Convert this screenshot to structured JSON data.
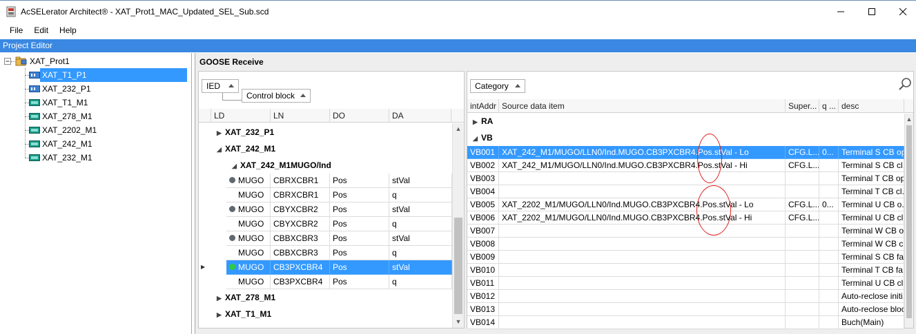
{
  "window": {
    "title": "AcSELerator Architect® - XAT_Prot1_MAC_Updated_SEL_Sub.scd"
  },
  "menu": [
    "File",
    "Edit",
    "Help"
  ],
  "project_editor": {
    "label": "Project Editor"
  },
  "tree": {
    "root": "XAT_Prot1",
    "items": [
      {
        "label": "XAT_T1_P1",
        "icon": "ied-blue-icon",
        "selected": true
      },
      {
        "label": "XAT_232_P1",
        "icon": "ied-blue-icon",
        "selected": false
      },
      {
        "label": "XAT_T1_M1",
        "icon": "ied-teal-icon",
        "selected": false
      },
      {
        "label": "XAT_278_M1",
        "icon": "ied-teal-icon",
        "selected": false
      },
      {
        "label": "XAT_2202_M1",
        "icon": "ied-teal-icon",
        "selected": false
      },
      {
        "label": "XAT_242_M1",
        "icon": "ied-teal-icon",
        "selected": false
      },
      {
        "label": "XAT_232_M1",
        "icon": "ied-teal-icon",
        "selected": false
      }
    ]
  },
  "goose": {
    "title": "GOOSE Receive",
    "left": {
      "group_buttons": [
        "IED",
        "Control block"
      ],
      "columns": [
        "LD",
        "LN",
        "DO",
        "DA"
      ],
      "groups": {
        "g1": "XAT_232_P1",
        "g2": "XAT_242_M1",
        "sub": "XAT_242_M1MUGO/Ind",
        "g3": "XAT_278_M1",
        "g4": "XAT_T1_M1"
      },
      "rows": [
        {
          "ld": "MUGO",
          "ln": "CBRXCBR1",
          "do": "Pos",
          "da": "stVal",
          "dot": "gray",
          "selected": false
        },
        {
          "ld": "MUGO",
          "ln": "CBRXCBR1",
          "do": "Pos",
          "da": "q",
          "dot": "none",
          "selected": false
        },
        {
          "ld": "MUGO",
          "ln": "CBYXCBR2",
          "do": "Pos",
          "da": "stVal",
          "dot": "gray",
          "selected": false
        },
        {
          "ld": "MUGO",
          "ln": "CBYXCBR2",
          "do": "Pos",
          "da": "q",
          "dot": "none",
          "selected": false
        },
        {
          "ld": "MUGO",
          "ln": "CBBXCBR3",
          "do": "Pos",
          "da": "stVal",
          "dot": "gray",
          "selected": false
        },
        {
          "ld": "MUGO",
          "ln": "CBBXCBR3",
          "do": "Pos",
          "da": "q",
          "dot": "none",
          "selected": false
        },
        {
          "ld": "MUGO",
          "ln": "CB3PXCBR4",
          "do": "Pos",
          "da": "stVal",
          "dot": "green",
          "selected": true
        },
        {
          "ld": "MUGO",
          "ln": "CB3PXCBR4",
          "do": "Pos",
          "da": "q",
          "dot": "none",
          "selected": false
        }
      ]
    },
    "right": {
      "group_button": "Category",
      "columns": [
        "intAddr",
        "Source data item",
        "Super...",
        "q ...",
        "desc"
      ],
      "groups": {
        "ra": "RA",
        "vb": "VB"
      },
      "rows": [
        {
          "addr": "VB001",
          "src": "XAT_242_M1/MUGO/LLN0/Ind.MUGO.CB3PXCBR4.Pos.stVal - Lo",
          "sup": "CFG.L...",
          "q": "0...",
          "desc": "Terminal S CB op...",
          "selected": true
        },
        {
          "addr": "VB002",
          "src": "XAT_242_M1/MUGO/LLN0/Ind.MUGO.CB3PXCBR4.Pos.stVal - Hi",
          "sup": "CFG.L...",
          "q": "",
          "desc": "Terminal S CB cl...",
          "selected": false
        },
        {
          "addr": "VB003",
          "src": "",
          "sup": "",
          "q": "",
          "desc": "Terminal T CB op...",
          "selected": false
        },
        {
          "addr": "VB004",
          "src": "",
          "sup": "",
          "q": "",
          "desc": "Terminal T CB cl...",
          "selected": false
        },
        {
          "addr": "VB005",
          "src": "XAT_2202_M1/MUGO/LLN0/Ind.MUGO.CB3PXCBR4.Pos.stVal - Lo",
          "sup": "CFG.L...",
          "q": "0...",
          "desc": "Terminal U CB o...",
          "selected": false
        },
        {
          "addr": "VB006",
          "src": "XAT_2202_M1/MUGO/LLN0/Ind.MUGO.CB3PXCBR4.Pos.stVal - Hi",
          "sup": "CFG.L...",
          "q": "",
          "desc": "Terminal U CB cl...",
          "selected": false
        },
        {
          "addr": "VB007",
          "src": "",
          "sup": "",
          "q": "",
          "desc": "Terminal W CB o...",
          "selected": false
        },
        {
          "addr": "VB008",
          "src": "",
          "sup": "",
          "q": "",
          "desc": "Terminal W CB cl...",
          "selected": false
        },
        {
          "addr": "VB009",
          "src": "",
          "sup": "",
          "q": "",
          "desc": "Terminal S CB fa...",
          "selected": false
        },
        {
          "addr": "VB010",
          "src": "",
          "sup": "",
          "q": "",
          "desc": "Terminal T CB fa...",
          "selected": false
        },
        {
          "addr": "VB011",
          "src": "",
          "sup": "",
          "q": "",
          "desc": "Terminal U CB cl...",
          "selected": false
        },
        {
          "addr": "VB012",
          "src": "",
          "sup": "",
          "q": "",
          "desc": "Auto-reclose initi...",
          "selected": false
        },
        {
          "addr": "VB013",
          "src": "",
          "sup": "",
          "q": "",
          "desc": "Auto-reclose block",
          "selected": false
        },
        {
          "addr": "VB014",
          "src": "",
          "sup": "",
          "q": "",
          "desc": "Buch(Main)",
          "selected": false
        }
      ]
    }
  },
  "colors": {
    "accent": "#3a88e1",
    "selection": "#3399ff",
    "annotation": "#e02020",
    "status_gray": "#606870",
    "status_green": "#2ecc40"
  }
}
